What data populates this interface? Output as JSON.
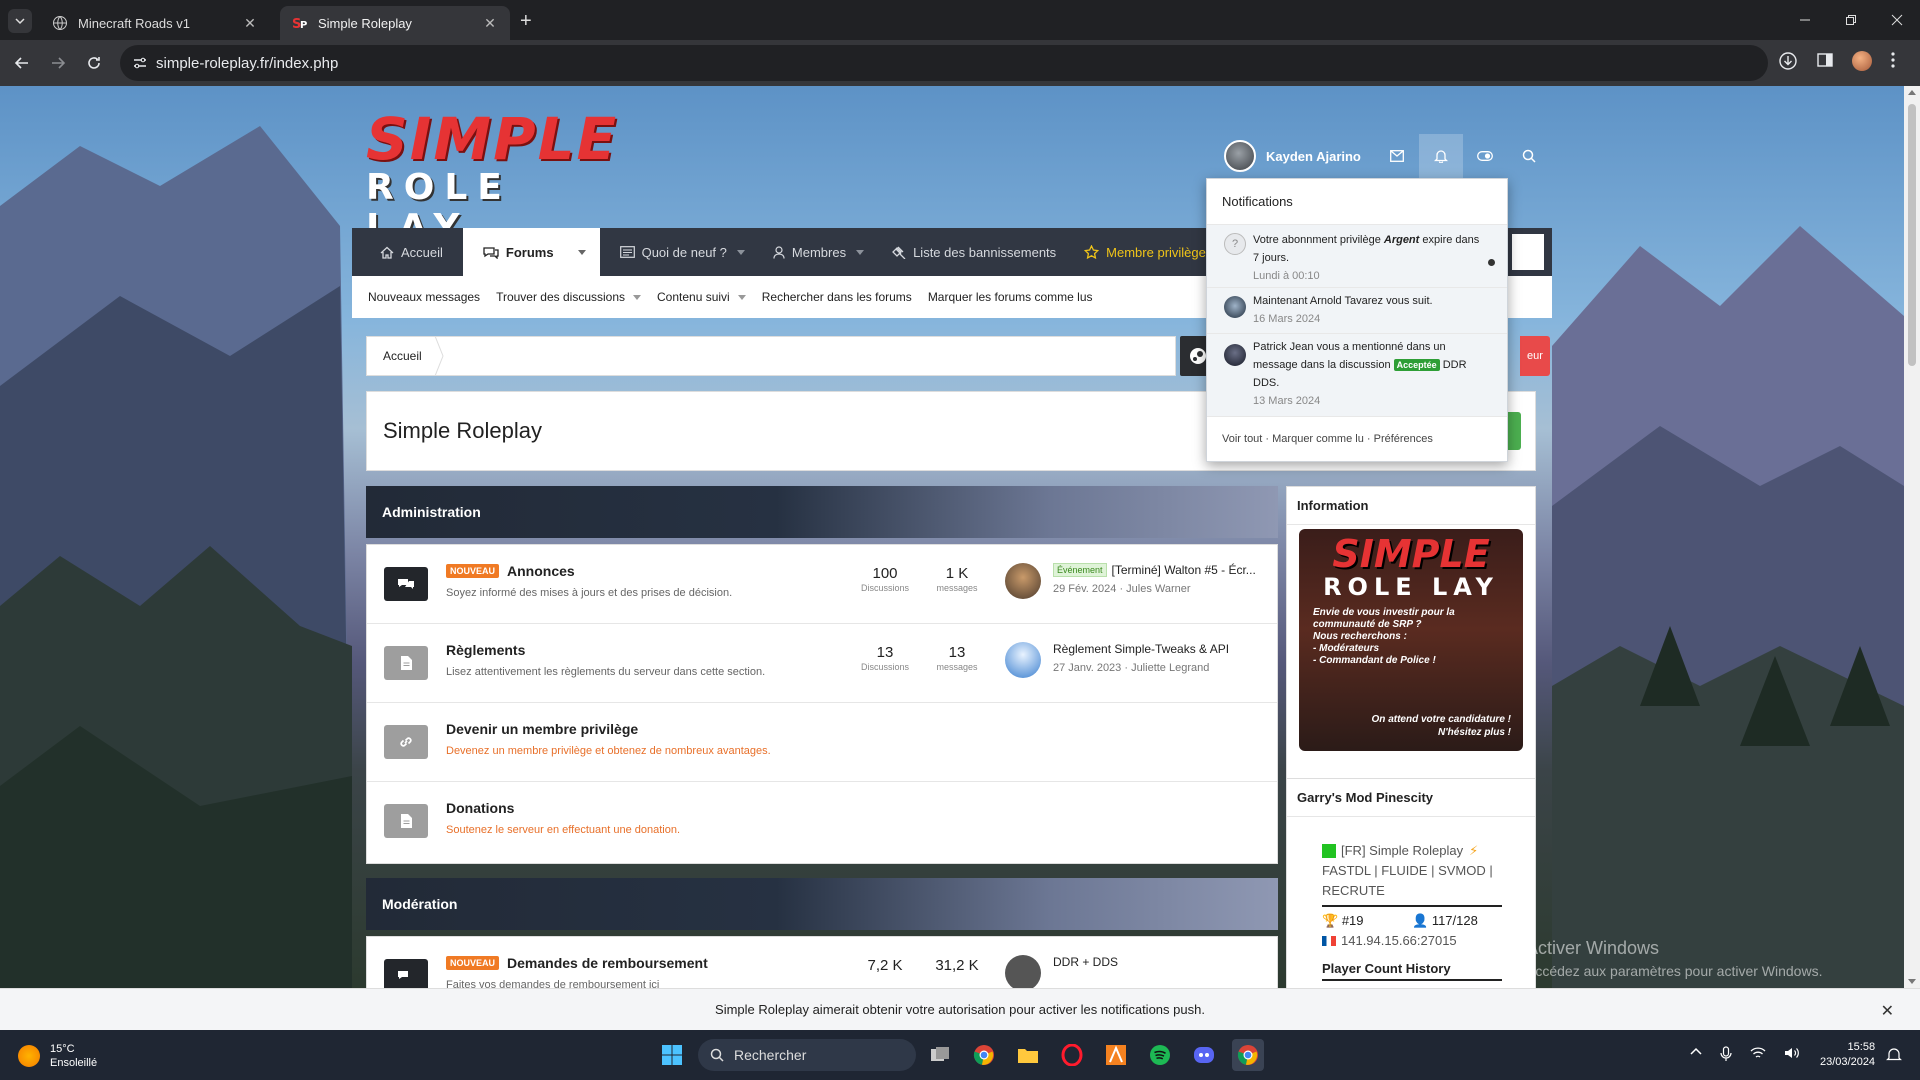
{
  "browser": {
    "tabs": [
      {
        "title": "Minecraft Roads v1",
        "active": false
      },
      {
        "title": "Simple Roleplay",
        "active": true
      }
    ],
    "url": "simple-roleplay.fr/index.php"
  },
  "site": {
    "logo_top": "SIMPLE",
    "logo_bottom": "ROLE LAY",
    "user": {
      "name": "Kayden Ajarino"
    },
    "nav": [
      {
        "label": "Accueil",
        "icon": "home-icon"
      },
      {
        "label": "Forums",
        "icon": "chat-icon",
        "selected": true
      },
      {
        "label": "Quoi de neuf ?",
        "icon": "newspaper-icon"
      },
      {
        "label": "Membres",
        "icon": "user-icon"
      },
      {
        "label": "Liste des bannissements",
        "icon": "gavel-icon"
      },
      {
        "label": "Membre privilège",
        "icon": "star-icon"
      }
    ],
    "subnav": [
      "Nouveaux messages",
      "Trouver des discussions",
      "Contenu suivi",
      "Rechercher dans les forums",
      "Marquer les forums comme lus"
    ],
    "breadcrumb": "Accueil",
    "crumb_button": "eur",
    "page_title": "Simple Roleplay",
    "categories": [
      {
        "title": "Administration",
        "nodes": [
          {
            "badge": "NOUVEAU",
            "title": "Annonces",
            "desc": "Soyez informé des mises à jours et des prises de décision.",
            "discussions": "100",
            "messages": "1 K",
            "discussions_label": "Discussions",
            "messages_label": "messages",
            "last_prefix": "Événement",
            "last_title": "[Terminé] Walton #5 - Écr...",
            "last_meta": "29 Fév. 2024 · Jules Warner"
          },
          {
            "title": "Règlements",
            "desc": "Lisez attentivement les règlements du serveur dans cette section.",
            "discussions": "13",
            "messages": "13",
            "discussions_label": "Discussions",
            "messages_label": "messages",
            "last_title": "Règlement Simple-Tweaks & API",
            "last_meta": "27 Janv. 2023 · Juliette Legrand"
          },
          {
            "title": "Devenir un membre privilège",
            "desc": "Devenez un membre privilège et obtenez de nombreux avantages."
          },
          {
            "title": "Donations",
            "desc": "Soutenez le serveur en effectuant une donation."
          }
        ]
      },
      {
        "title": "Modération",
        "nodes": [
          {
            "badge": "NOUVEAU",
            "title": "Demandes de remboursement",
            "desc": "Faites vos demandes de remboursement ici",
            "discussions": "7,2 K",
            "messages": "31,2 K",
            "last_title": "DDR + DDS"
          }
        ]
      }
    ],
    "sidebar": {
      "info_title": "Information",
      "banner": {
        "logo_top": "SIMPLE",
        "logo_bottom": "ROLE LAY",
        "text1": "Envie de vous investir pour la communauté de SRP ?",
        "text2": "Nous recherchons :",
        "text3": "- Modérateurs",
        "text4": "- Commandant de Police !",
        "text5": "On attend votre candidature !",
        "text6": "N'hésitez plus !"
      },
      "server_title": "Garry's Mod Pinescity",
      "server": {
        "name": "[FR] Simple Roleplay",
        "tags": "FASTDL | FLUIDE | SVMOD | RECRUTE",
        "rank": "#19",
        "players": "117/128",
        "address": "141.94.15.66:27015",
        "history": "Player Count History"
      }
    },
    "notifications": {
      "title": "Notifications",
      "items": [
        {
          "pre": "Votre abonnment privilège ",
          "bold": "Argent",
          "post": " expire dans 7 jours.",
          "time": "Lundi à 00:10",
          "unread": true
        },
        {
          "pre": "Maintenant ",
          "bold": "Arnold Tavarez",
          "post": " vous suit.",
          "time": "16 Mars 2024"
        },
        {
          "pre": "Patrick Jean vous a mentionné dans un message dans la discussion ",
          "tag": "Acceptée",
          "post": " DDR DDS.",
          "time": "13 Mars 2024"
        }
      ],
      "footer": "Voir tout · Marquer comme lu · Préférences"
    },
    "push_prompt": "Simple Roleplay aimerait obtenir votre autorisation pour activer les notifications push."
  },
  "watermark": {
    "line1": "Activer Windows",
    "line2": "Accédez aux paramètres pour activer Windows."
  },
  "taskbar": {
    "weather_temp": "15°C",
    "weather_desc": "Ensoleillé",
    "search": "Rechercher",
    "time": "15:58",
    "date": "23/03/2024"
  },
  "colors": {
    "accent_red": "#e63334",
    "nav_bg": "#313743",
    "badge_orange": "#f07a24"
  }
}
